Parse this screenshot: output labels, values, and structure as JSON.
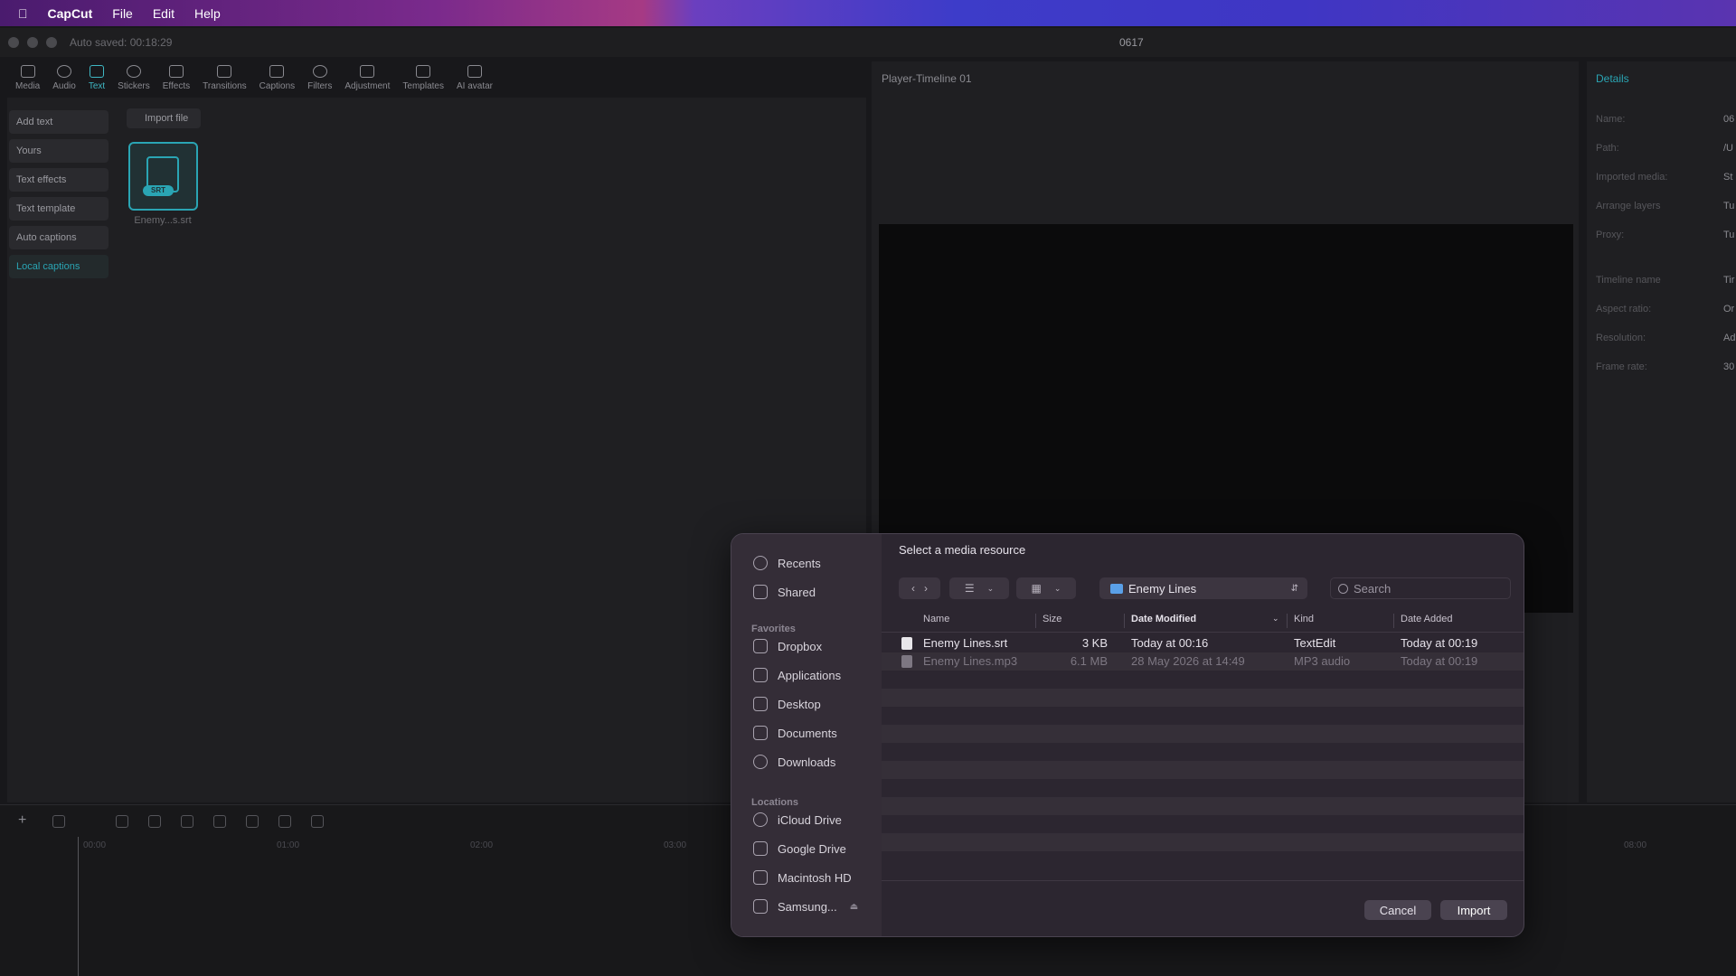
{
  "menubar": {
    "app": "CapCut",
    "items": [
      "File",
      "Edit",
      "Help"
    ]
  },
  "window": {
    "autosave": "Auto saved: 00:18:29",
    "project": "0617"
  },
  "toolbar": [
    "Media",
    "Audio",
    "Text",
    "Stickers",
    "Effects",
    "Transitions",
    "Captions",
    "Filters",
    "Adjustment",
    "Templates",
    "AI avatar"
  ],
  "left": {
    "side": [
      "Add text",
      "Yours",
      "Text effects",
      "Text template",
      "Auto captions",
      "Local captions"
    ],
    "import": "Import file",
    "thumb_label": "Enemy...s.srt",
    "thumb_badge": "SRT"
  },
  "player": {
    "title": "Player-Timeline 01"
  },
  "details": {
    "title": "Details",
    "labels": [
      "Name:",
      "Path:",
      "Imported media:",
      "Arrange layers",
      "Proxy:",
      "Timeline name",
      "Aspect ratio:",
      "Resolution:",
      "Frame rate:"
    ],
    "values": [
      "06",
      "/U",
      "St",
      "Tu",
      "Tu",
      "Tir",
      "Or",
      "Ad",
      "30"
    ]
  },
  "timeline": {
    "ticks": [
      "00:00",
      "01:00",
      "02:00",
      "03:00",
      "08:00"
    ]
  },
  "dialog": {
    "title": "Select a media resource",
    "sidebar": {
      "top": [
        "Recents",
        "Shared"
      ],
      "favorites_label": "Favorites",
      "favorites": [
        "Dropbox",
        "Applications",
        "Desktop",
        "Documents",
        "Downloads"
      ],
      "locations_label": "Locations",
      "locations": [
        "iCloud Drive",
        "Google Drive",
        "Macintosh HD",
        "Samsung..."
      ]
    },
    "location": "Enemy Lines",
    "search_placeholder": "Search",
    "columns": [
      "Name",
      "Size",
      "Date Modified",
      "Kind",
      "Date Added"
    ],
    "files": [
      {
        "name": "Enemy Lines.srt",
        "size": "3 KB",
        "modified": "Today at 00:16",
        "kind": "TextEdit",
        "added": "Today at 00:19"
      },
      {
        "name": "Enemy Lines.mp3",
        "size": "6.1 MB",
        "modified": "28 May 2026 at 14:49",
        "kind": "MP3 audio",
        "added": "Today at 00:19"
      }
    ],
    "cancel": "Cancel",
    "import": "Import"
  }
}
